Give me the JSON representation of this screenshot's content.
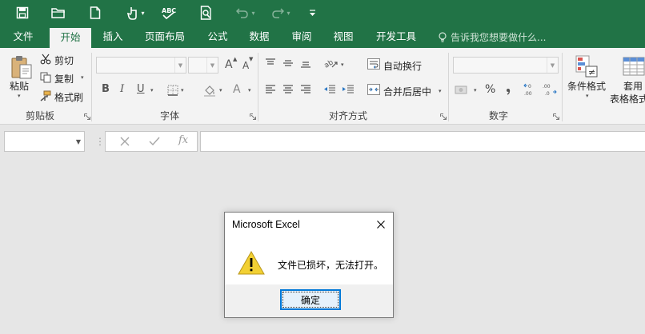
{
  "colors": {
    "accent": "#217346",
    "ribbon_bg": "#f3f3f3",
    "workspace_bg": "#e6e6e6",
    "dialog_focus": "#0078d7",
    "warning_yellow": "#f2d033"
  },
  "quick_access": {
    "icons": [
      "save-icon",
      "open-folder-icon",
      "new-file-icon",
      "touch-mode-icon",
      "spelling-icon",
      "print-preview-icon",
      "undo-icon",
      "redo-icon",
      "customize-icon"
    ]
  },
  "tabs": [
    {
      "label": "文件",
      "active": false
    },
    {
      "label": "开始",
      "active": true
    },
    {
      "label": "插入",
      "active": false
    },
    {
      "label": "页面布局",
      "active": false
    },
    {
      "label": "公式",
      "active": false
    },
    {
      "label": "数据",
      "active": false
    },
    {
      "label": "审阅",
      "active": false
    },
    {
      "label": "视图",
      "active": false
    },
    {
      "label": "开发工具",
      "active": false
    }
  ],
  "tell_me": "告诉我您想要做什么...",
  "clipboard": {
    "paste": "粘贴",
    "cut": "剪切",
    "copy": "复制",
    "format_painter": "格式刷",
    "group": "剪贴板"
  },
  "font": {
    "font_name": "",
    "font_size": "",
    "grow": "A",
    "shrink": "A",
    "bold": "B",
    "italic": "I",
    "underline": "U",
    "font_color": "A",
    "group": "字体"
  },
  "alignment": {
    "wrap_text": "自动换行",
    "merge_center": "合并后居中",
    "group": "对齐方式"
  },
  "number": {
    "format": "",
    "percent": "%",
    "group": "数字"
  },
  "styles": {
    "conditional_formatting": "条件格式",
    "table_format_line1": "套用",
    "table_format_line2": "表格格式"
  },
  "formula_bar": {
    "name_box": "",
    "fx": "fx",
    "formula": ""
  },
  "dialog": {
    "title": "Microsoft Excel",
    "message": "文件已损坏，无法打开。",
    "ok": "确定"
  }
}
